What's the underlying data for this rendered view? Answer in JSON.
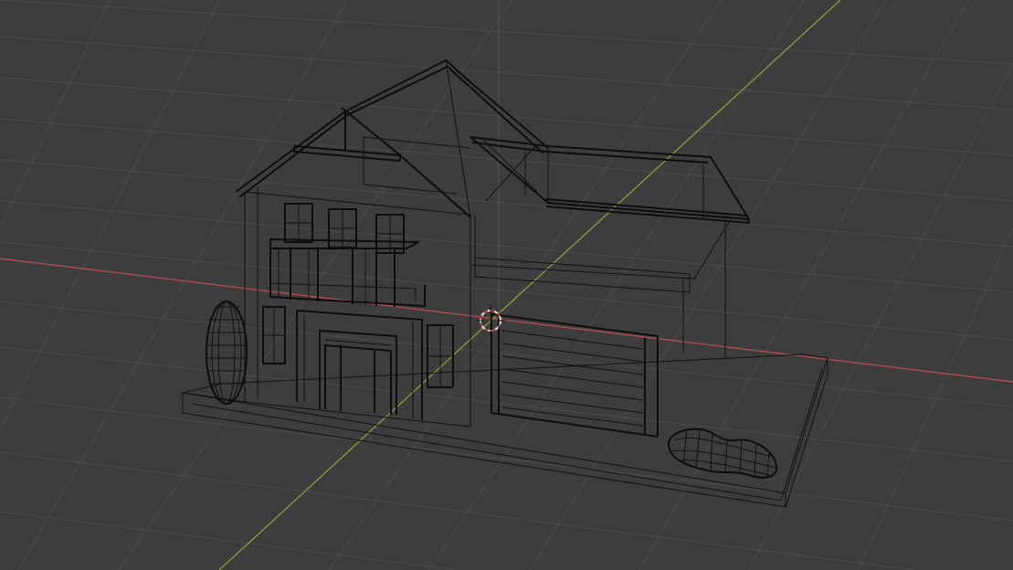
{
  "viewport": {
    "mode": "wireframe",
    "background_color": "#3d3d3d",
    "grid_color": "#4b4b4b",
    "x_axis_color": "#b04a55",
    "y_axis_color": "#7d9c3a",
    "wire_color": "#111111",
    "cursor_color_a": "#e8e8e8",
    "cursor_color_b": "#c04040"
  },
  "scene": {
    "objects": [
      "house",
      "garage",
      "ground-slab",
      "shrub",
      "bush"
    ]
  }
}
